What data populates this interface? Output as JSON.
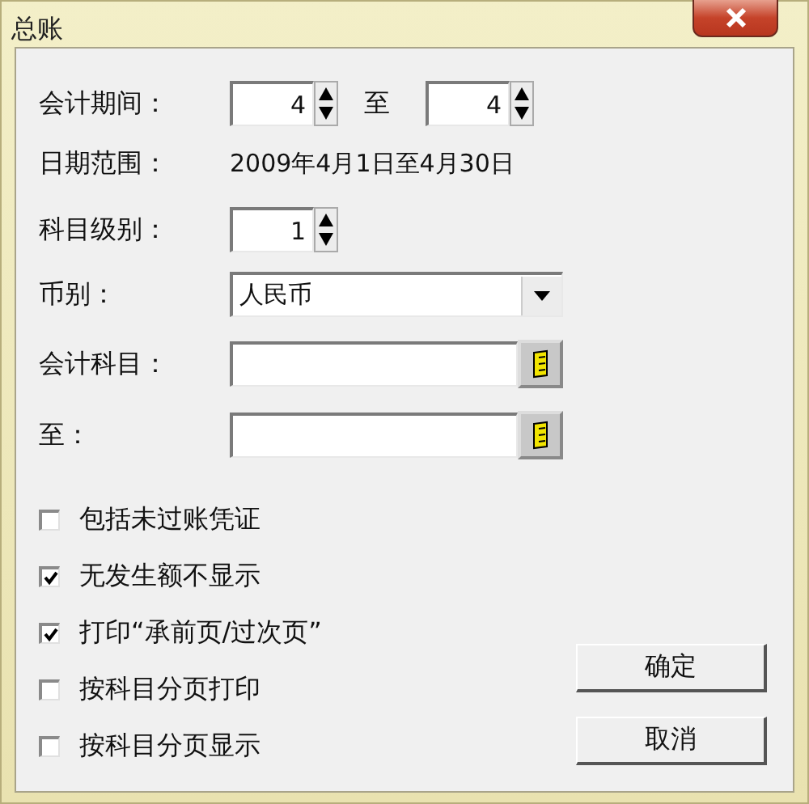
{
  "window": {
    "title": "总账"
  },
  "period": {
    "label": "会计期间：",
    "from": "4",
    "separator": "至",
    "to": "4"
  },
  "date_range": {
    "label": "日期范围：",
    "value": "2009年4月1日至4月30日"
  },
  "level": {
    "label": "科目级别：",
    "value": "1"
  },
  "currency": {
    "label": "币别：",
    "value": "人民币"
  },
  "account_from": {
    "label": "会计科目："
  },
  "account_to": {
    "label": "至："
  },
  "checkboxes": [
    {
      "label": "包括未过账凭证",
      "checked": false
    },
    {
      "label": "无发生额不显示",
      "checked": true
    },
    {
      "label": "打印“承前页/过次页”",
      "checked": true
    },
    {
      "label": "按科目分页打印",
      "checked": false
    },
    {
      "label": "按科目分页显示",
      "checked": false
    }
  ],
  "buttons": [
    "确定",
    "取消"
  ]
}
